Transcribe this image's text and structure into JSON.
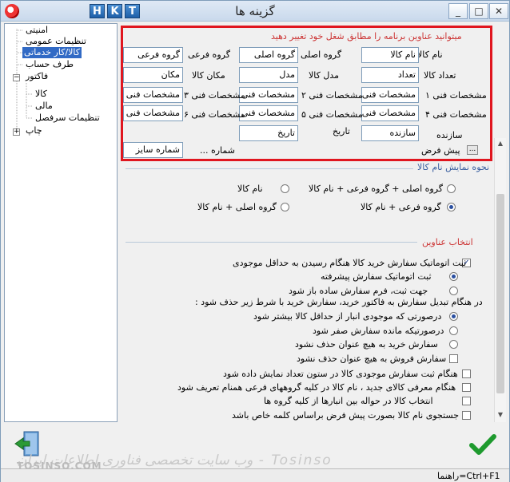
{
  "window": {
    "title": "گزینه ها",
    "title_buttons": [
      "H",
      "K",
      "T"
    ],
    "controls": {
      "minimize": "_",
      "maximize": "□",
      "close": "✕"
    }
  },
  "tree": {
    "items": [
      {
        "label": "امنیتی"
      },
      {
        "label": "تنظیمات عمومی"
      },
      {
        "label": "کالا/کار خدماتی"
      },
      {
        "label": "طرف حساب"
      },
      {
        "label": "فاکتور"
      },
      {
        "label": "کالا"
      },
      {
        "label": "مالی"
      },
      {
        "label": "تنظیمات سرفصل"
      },
      {
        "label": "چاپ"
      }
    ]
  },
  "titles_group": {
    "caption": "میتوانید عناوین برنامه را مطابق شغل خود تغییر دهید",
    "rows": [
      [
        {
          "label": "نام کالا",
          "value": "نام کالا"
        },
        {
          "label": "گروه اصلی",
          "value": "گروه اصلی"
        },
        {
          "label": "گروه فرعی",
          "value": "گروه فرعی"
        }
      ],
      [
        {
          "label": "تعداد کالا",
          "value": "تعداد"
        },
        {
          "label": "مدل کالا",
          "value": "مدل"
        },
        {
          "label": "مکان کالا",
          "value": "مکان"
        }
      ],
      [
        {
          "label": "مشخصات فنی ۱",
          "value": "مشخصات فنی"
        },
        {
          "label": "مشخصات فنی ۲",
          "value": "مشخصات فنی"
        },
        {
          "label": "مشخصات فنی ۳",
          "value": "مشخصات فنی"
        }
      ],
      [
        {
          "label": "مشخصات فنی ۴",
          "value": "مشخصات فنی"
        },
        {
          "label": "مشخصات فنی ۵",
          "value": "مشخصات فنی"
        },
        {
          "label": "مشخصات فنی ۶",
          "value": "مشخصات فنی"
        }
      ],
      [
        {
          "label": "سازنده",
          "value": "سازنده"
        },
        {
          "label": "تاریخ",
          "value": "تاریخ"
        }
      ]
    ],
    "default_label": "پیش فرض",
    "default_btn": "...",
    "number_label": "شماره ...",
    "number_value": "شماره سایز"
  },
  "display_group": {
    "caption": "نحوه نمایش نام کالا",
    "options": [
      {
        "label": "گروه اصلی + گروه فرعی + نام کالا"
      },
      {
        "label": "نام کالا"
      },
      {
        "label": "گروه فرعی + نام کالا"
      },
      {
        "label": "گروه اصلی + نام کالا"
      }
    ]
  },
  "auto_group": {
    "caption": "انتخاب عناوین",
    "auto_order": "ثبت اتوماتیک سفارش خرید کالا هنگام رسیدن به حداقل موجودی",
    "auto_adv": "ثبت اتوماتیک سفارش پیشرفته",
    "auto_simple": "جهت ثبت، فرم سفارش ساده باز شود",
    "convert_note": "در هنگام تبدیل سفارش به فاکتور خرید، سفارش خرید با شرط زیر حذف شود :",
    "del_opts": [
      "درصورتی که موجودی انبار از حداقل کالا بیشتر شود",
      "درصورتیکه مانده سفارش صفر شود",
      "سفارش خرید به هیچ عنوان حذف نشود"
    ],
    "sale_never": "سفارش فروش به هیچ عنوان حذف نشود",
    "checks": [
      "هنگام ثبت سفارش موجودی کالا در ستون تعداد نمایش داده شود",
      "هنگام معرفی کالای جدید ، نام کالا در کلیه گروههای فرعی همنام تعریف شود",
      "انتخاب کالا در حواله بین انبارها از کلیه گروه ها",
      "جستجوی نام کالا بصورت پیش فرض براساس کلمه خاص باشد"
    ]
  },
  "footer": {
    "watermark": "Tosinso - وب سایت تخصصی فناوری اطلاعات ایران",
    "watermark_site": "TOSINSO.COM",
    "status_hint": "راهنما=Ctrl+F1"
  },
  "colors": {
    "highlight": "#e0161f",
    "accent": "#316ac5",
    "check": "#1e9a2e"
  }
}
